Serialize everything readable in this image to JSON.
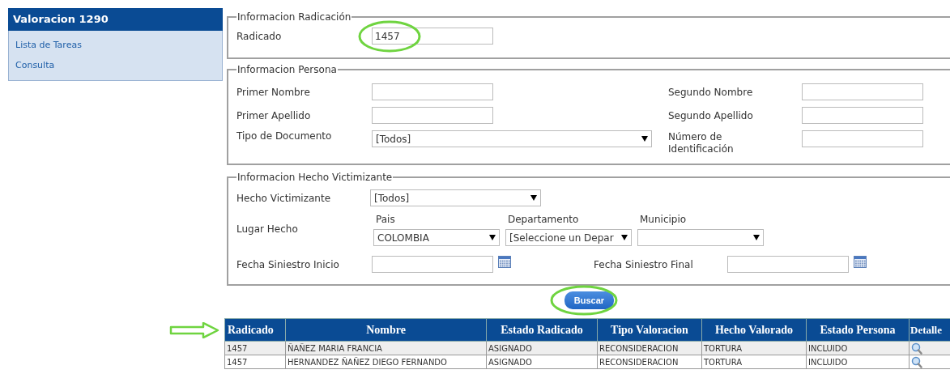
{
  "sidebar": {
    "title": "Valoracion 1290",
    "items": [
      {
        "label": "Lista de Tareas"
      },
      {
        "label": "Consulta"
      }
    ]
  },
  "radicacion": {
    "legend": "Informacion Radicación",
    "radicado": {
      "label": "Radicado",
      "value": "1457"
    }
  },
  "persona": {
    "legend": "Informacion Persona",
    "fields": [
      {
        "label": "Primer Nombre",
        "kind": "text"
      },
      {
        "label": "Segundo Nombre",
        "kind": "text"
      },
      {
        "label": "Primer Apellido",
        "kind": "text"
      },
      {
        "label": "Segundo Apellido",
        "kind": "text"
      },
      {
        "label": "Tipo de Documento",
        "kind": "select",
        "value": "[Todos]"
      },
      {
        "label": "Número de Identificación",
        "kind": "text"
      }
    ]
  },
  "hecho": {
    "legend": "Informacion Hecho Victimizante",
    "hecho_victimizante": {
      "label": "Hecho Victimizante",
      "value": "[Todos]"
    },
    "lugar": {
      "label": "Lugar Hecho",
      "selects": [
        {
          "label": "Pais",
          "value": "COLOMBIA"
        },
        {
          "label": "Departamento",
          "value": "[Seleccione un Depar"
        },
        {
          "label": "Municipio"
        }
      ]
    },
    "fecha_inicio": {
      "label": "Fecha Siniestro Inicio"
    },
    "fecha_final": {
      "label": "Fecha Siniestro Final"
    }
  },
  "search_button": "Buscar",
  "table": {
    "columns": [
      "Radicado",
      "Nombre",
      "Estado Radicado",
      "Tipo Valoracion",
      "Hecho Valorado",
      "Estado Persona",
      "Detalle"
    ],
    "rows": [
      [
        "1457",
        "ÑAÑEZ MARIA FRANCIA",
        "ASIGNADO",
        "RECONSIDERACION",
        "TORTURA",
        "INCLUIDO"
      ],
      [
        "1457",
        "HERNANDEZ ÑAÑEZ DIEGO FERNANDO",
        "ASIGNADO",
        "RECONSIDERACION",
        "TORTURA",
        "INCLUIDO"
      ]
    ]
  }
}
